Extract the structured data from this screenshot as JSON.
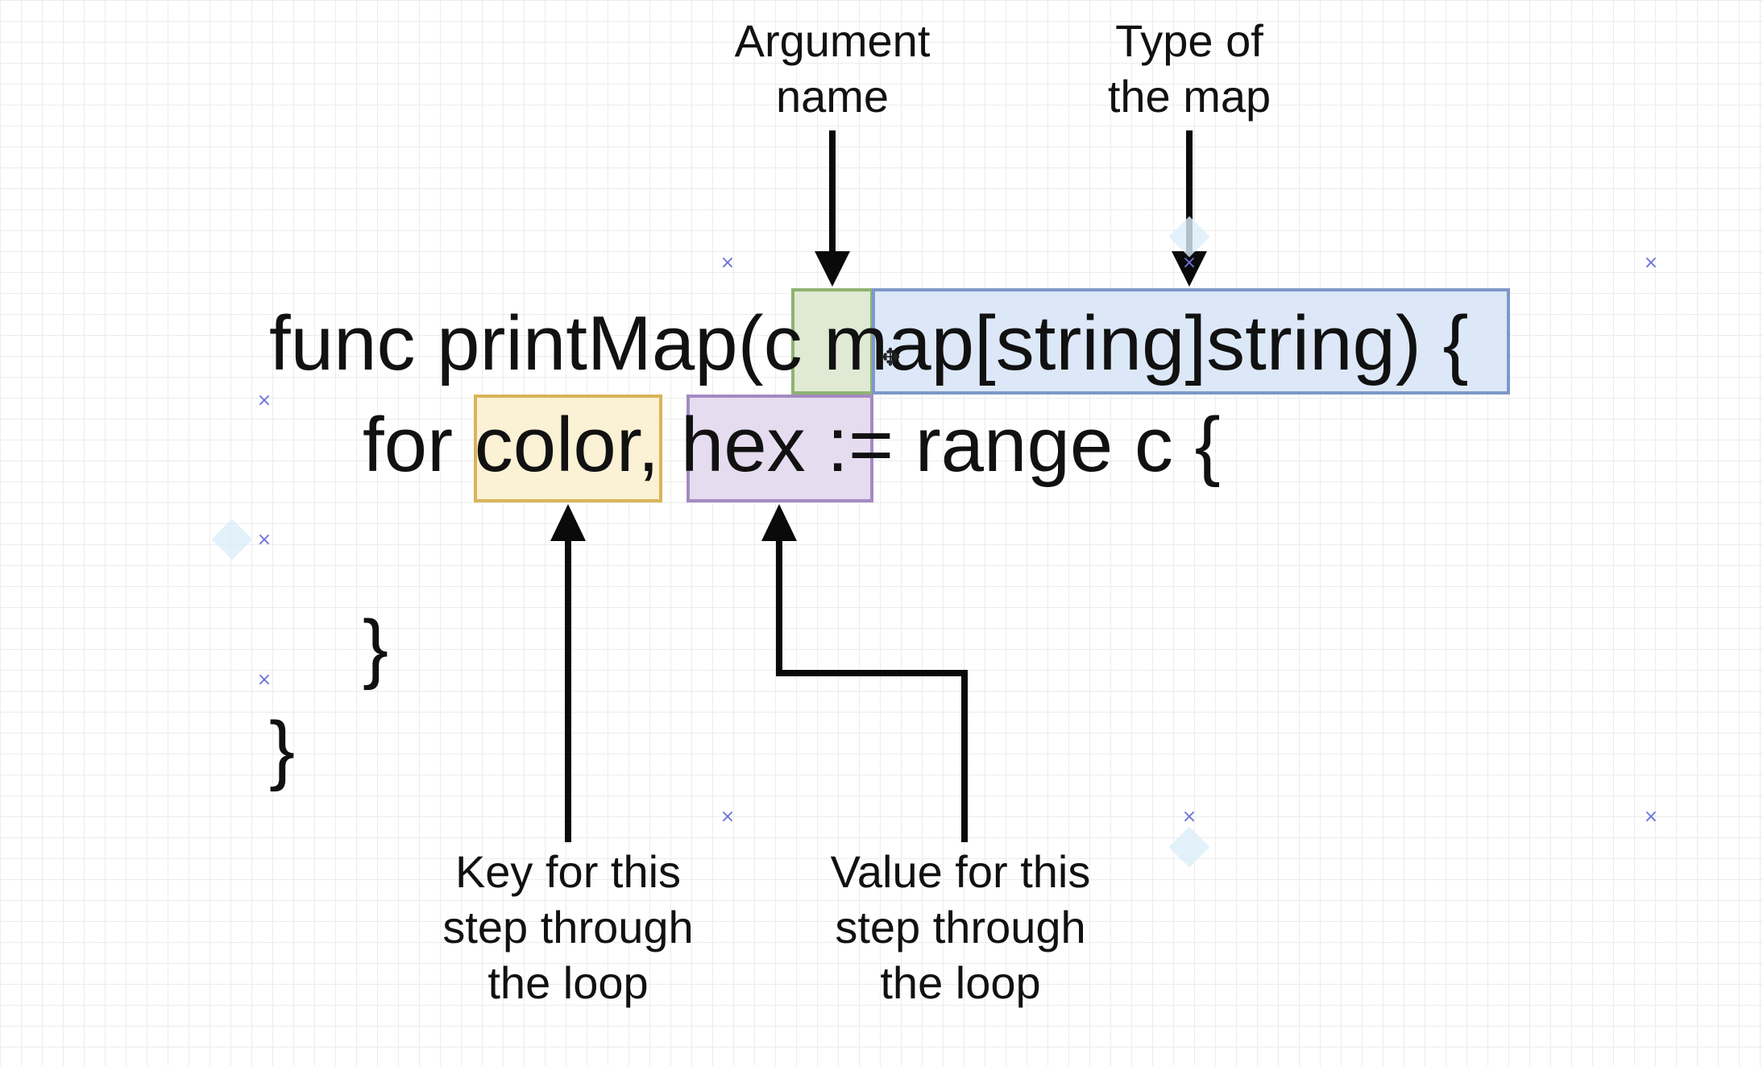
{
  "code": {
    "line1": "func printMap(c map[string]string) {",
    "line2": "for color, hex := range c {",
    "line3": "}",
    "line4": "}"
  },
  "highlights": {
    "argument": {
      "text": "c",
      "fill": "#dfe9d3",
      "border": "#8fb372"
    },
    "map_type": {
      "text": "map[string]string",
      "fill": "#dce8f8",
      "border": "#7d99c8"
    },
    "key": {
      "text": "color",
      "fill": "#fbf1d4",
      "border": "#d9b459"
    },
    "value": {
      "text": "hex",
      "fill": "#e6dcef",
      "border": "#a48ac2"
    }
  },
  "labels": {
    "argument_name": [
      "Argument",
      "name"
    ],
    "map_type": [
      "Type of",
      "the map"
    ],
    "key": [
      "Key for this",
      "step through",
      "the loop"
    ],
    "value": [
      "Value for this",
      "step through",
      "the loop"
    ]
  },
  "colors": {
    "grid": "#ececec",
    "arrow": "#0a0a0a",
    "handle": "#6f72d8",
    "selection_diamond": "#dbeef9"
  },
  "icons": {
    "selection_handle": "x-mark-icon",
    "cursor": "move-cursor-icon"
  }
}
